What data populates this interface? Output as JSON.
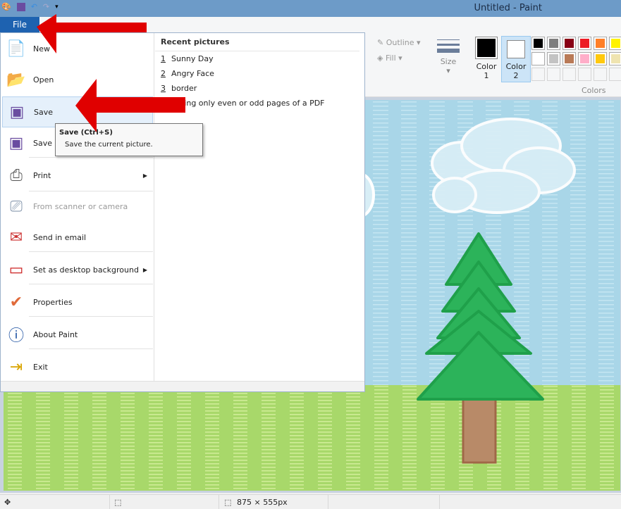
{
  "window": {
    "title": "Untitled - Paint"
  },
  "qat": {
    "icons": [
      "paint-app-icon",
      "save-icon",
      "undo-icon",
      "redo-icon",
      "customize-icon"
    ]
  },
  "file_tab": "File",
  "menu": {
    "items": [
      {
        "label": "New",
        "icon": "new-icon"
      },
      {
        "label": "Open",
        "icon": "open-folder-icon"
      },
      {
        "label": "Save",
        "icon": "save-disk-icon",
        "highlighted": true
      },
      {
        "label": "Save as",
        "icon": "save-as-icon",
        "submenu": true
      },
      {
        "label": "Print",
        "icon": "printer-icon",
        "submenu": true
      },
      {
        "label": "From scanner or camera",
        "icon": "scanner-icon",
        "disabled": true
      },
      {
        "label": "Send in email",
        "icon": "email-icon"
      },
      {
        "label": "Set as desktop background",
        "icon": "desktop-icon",
        "submenu": true
      },
      {
        "label": "Properties",
        "icon": "checkmark-icon"
      },
      {
        "label": "About Paint",
        "icon": "info-icon"
      },
      {
        "label": "Exit",
        "icon": "exit-icon"
      }
    ],
    "recent_title": "Recent pictures",
    "recent": [
      {
        "n": "1",
        "name": "Sunny Day"
      },
      {
        "n": "2",
        "name": "Angry Face"
      },
      {
        "n": "3",
        "name": "border"
      },
      {
        "n": "",
        "name": "Printing only even or odd pages of a PDF"
      }
    ]
  },
  "tooltip": {
    "title": "Save (Ctrl+S)",
    "desc": "Save the current picture."
  },
  "ribbon": {
    "outline": "Outline",
    "fill": "Fill",
    "size": "Size",
    "color1": "Color 1",
    "color2": "Color 2",
    "colors": "Colors",
    "palette": [
      "#000000",
      "#7f7f7f",
      "#880015",
      "#ed1c24",
      "#ff7f27",
      "#fff200",
      "#ffffff",
      "#c3c3c3",
      "#b97a57",
      "#ffaec9",
      "#ffc90e",
      "#efe4b0"
    ],
    "color1_value": "#000000",
    "color2_value": "#ffffff"
  },
  "status": {
    "canvas_size": "875 × 555px"
  },
  "annotation_color": "#e00000"
}
